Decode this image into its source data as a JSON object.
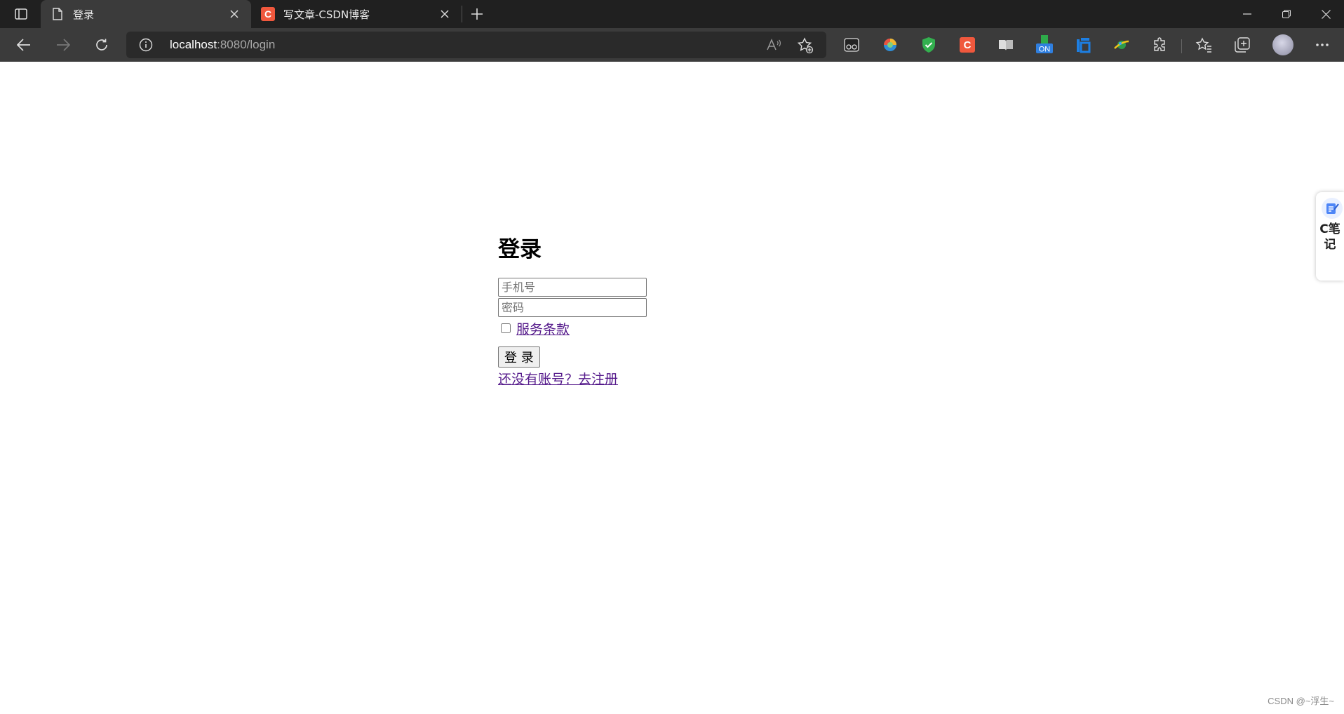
{
  "browser": {
    "tabs": [
      {
        "title": "登录",
        "active": true
      },
      {
        "title": "写文章-CSDN博客",
        "active": false,
        "favicon_letter": "C"
      }
    ],
    "address": {
      "host": "localhost",
      "rest": ":8080/login"
    }
  },
  "login": {
    "heading": "登录",
    "phone_placeholder": "手机号",
    "password_placeholder": "密码",
    "terms_label": "服务条款",
    "submit_label": "登 录",
    "register_link": "还没有账号？去注册"
  },
  "side_widget": {
    "text": "C笔记"
  },
  "watermark": "CSDN @~浮生~",
  "colors": {
    "tabbar": "#202020",
    "toolbar": "#3b3b3b",
    "visited_link": "#551a8b",
    "csdn": "#f0583d"
  }
}
